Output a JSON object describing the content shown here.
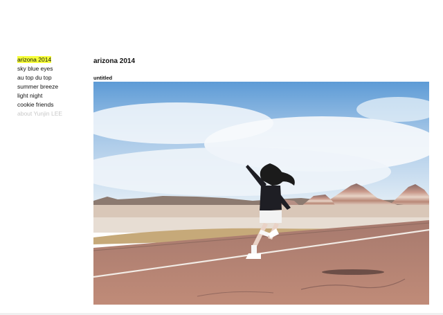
{
  "sidebar": {
    "items": [
      {
        "label": "arizona 2014",
        "active": true
      },
      {
        "label": "sky blue eyes"
      },
      {
        "label": "au top du top"
      },
      {
        "label": "summer breeze"
      },
      {
        "label": "light night"
      },
      {
        "label": "cookie friends"
      },
      {
        "label": "about Yunjin LEE",
        "muted": true
      }
    ]
  },
  "main": {
    "title": "arizona 2014",
    "caption": "untitled"
  },
  "colors": {
    "highlight": "#f6ff3a",
    "muted_text": "#c8c8c8"
  }
}
